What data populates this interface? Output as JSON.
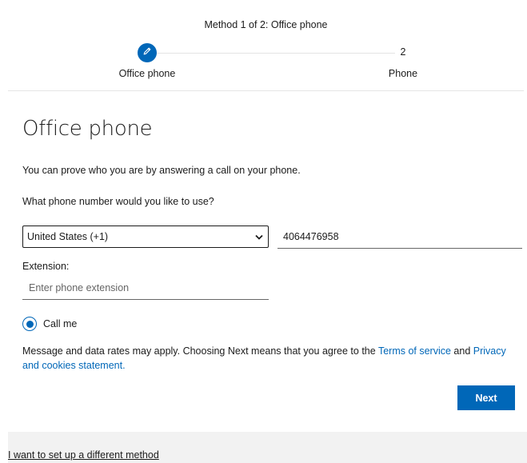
{
  "stepper": {
    "title": "Method 1 of 2: Office phone",
    "step1_label": "Office phone",
    "step2_number": "2",
    "step2_label": "Phone",
    "step1_icon": "pencil-icon",
    "accent_color": "#0067b8"
  },
  "form": {
    "heading": "Office phone",
    "description": "You can prove who you are by answering a call on your phone.",
    "question": "What phone number would you like to use?",
    "country_selected": "United States (+1)",
    "phone_value": "4064476958",
    "extension_label": "Extension:",
    "extension_placeholder": "Enter phone extension",
    "radio_label": "Call me",
    "radio_checked": true
  },
  "legal": {
    "text_before": "Message and data rates may apply. Choosing Next means that you agree to the ",
    "terms_link": "Terms of service",
    "text_middle": " and ",
    "privacy_link": "Privacy and cookies statement."
  },
  "actions": {
    "next_label": "Next"
  },
  "footer": {
    "alt_method_link": "I want to set up a different method"
  }
}
